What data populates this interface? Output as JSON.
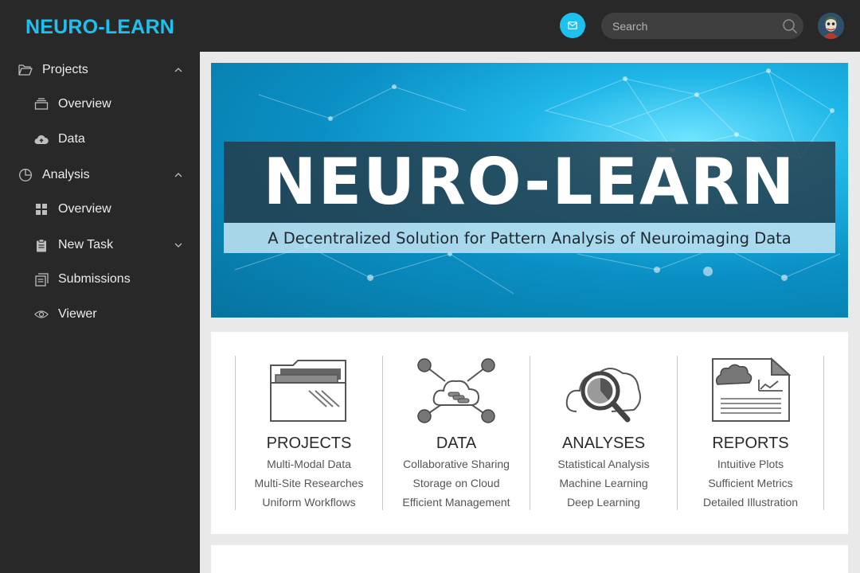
{
  "app": {
    "brand": "NEURO-LEARN"
  },
  "sidebar": {
    "items": [
      {
        "label": "Projects",
        "icon": "folder-open-icon",
        "expanded": true
      },
      {
        "label": "Overview",
        "icon": "stack-icon"
      },
      {
        "label": "Data",
        "icon": "cloud-upload-icon"
      },
      {
        "label": "Analysis",
        "icon": "pie-chart-icon",
        "expanded": true
      },
      {
        "label": "Overview",
        "icon": "grid-icon"
      },
      {
        "label": "New Task",
        "icon": "clipboard-icon",
        "expanded": false
      },
      {
        "label": "Submissions",
        "icon": "documents-icon"
      },
      {
        "label": "Viewer",
        "icon": "eye-icon"
      }
    ]
  },
  "header": {
    "mail_icon": "mail-icon",
    "search": {
      "placeholder": "Search",
      "value": ""
    },
    "avatar_icon": "user-avatar"
  },
  "banner": {
    "title": "NEURO-LEARN",
    "subtitle": "A Decentralized Solution for Pattern Analysis of Neuroimaging Data"
  },
  "features": [
    {
      "title": "PROJECTS",
      "icon": "folder-icon",
      "lines": [
        "Multi-Modal Data",
        "Multi-Site Researches",
        "Uniform Workflows"
      ]
    },
    {
      "title": "DATA",
      "icon": "cloud-network-icon",
      "lines": [
        "Collaborative Sharing",
        "Storage on Cloud",
        "Efficient Management"
      ]
    },
    {
      "title": "ANALYSES",
      "icon": "cloud-magnifier-icon",
      "lines": [
        "Statistical Analysis",
        "Machine Learning",
        "Deep Learning"
      ]
    },
    {
      "title": "REPORTS",
      "icon": "report-icon",
      "lines": [
        "Intuitive Plots",
        "Sufficient Metrics",
        "Detailed Illustration"
      ]
    }
  ],
  "colors": {
    "accent": "#1ec0f0",
    "sidebar_bg": "#282828",
    "page_bg": "#e9e9e9"
  }
}
